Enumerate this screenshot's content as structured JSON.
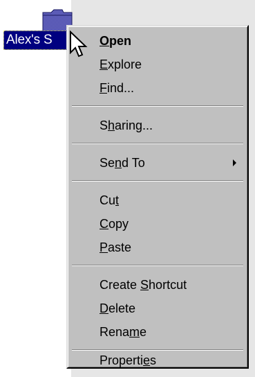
{
  "desktop": {
    "folder_label": "Alex's S"
  },
  "menu": {
    "items": [
      {
        "label": "Open",
        "mnemonic_index": 0,
        "bold": true
      },
      {
        "label": "Explore",
        "mnemonic_index": 0
      },
      {
        "label": "Find...",
        "mnemonic_index": 0
      },
      {
        "label": "Sharing...",
        "mnemonic_index": 1
      },
      {
        "label": "Send To",
        "mnemonic_index": 2,
        "submenu": true
      },
      {
        "label": "Cut",
        "mnemonic_index": 2
      },
      {
        "label": "Copy",
        "mnemonic_index": 0
      },
      {
        "label": "Paste",
        "mnemonic_index": 0
      },
      {
        "label": "Create Shortcut",
        "mnemonic_index": 7
      },
      {
        "label": "Delete",
        "mnemonic_index": 0
      },
      {
        "label": "Rename",
        "mnemonic_index": 4
      },
      {
        "label": "Properties",
        "mnemonic_index": 8
      }
    ]
  },
  "colors": {
    "menu_face": "#c0c0c0",
    "selection": "#000080",
    "desktop": "#ffffff"
  },
  "icons": {
    "folder": "folder-icon",
    "cursor": "mouse-pointer-icon",
    "submenu": "submenu-arrow-icon"
  }
}
